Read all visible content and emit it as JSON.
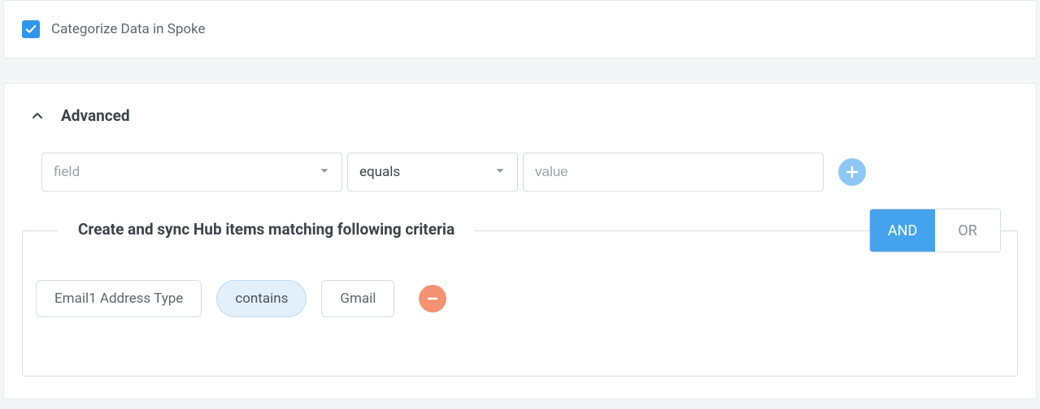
{
  "categorize": {
    "label": "Categorize Data in Spoke",
    "checked": true
  },
  "advanced": {
    "title": "Advanced",
    "builder": {
      "field_placeholder": "field",
      "op_selected": "equals",
      "value_placeholder": "value"
    },
    "criteria": {
      "title": "Create and sync Hub items matching following criteria",
      "logic_and": "AND",
      "logic_or": "OR",
      "active_logic": "AND",
      "row": {
        "field": "Email1 Address Type",
        "op": "contains",
        "value": "Gmail"
      }
    }
  }
}
